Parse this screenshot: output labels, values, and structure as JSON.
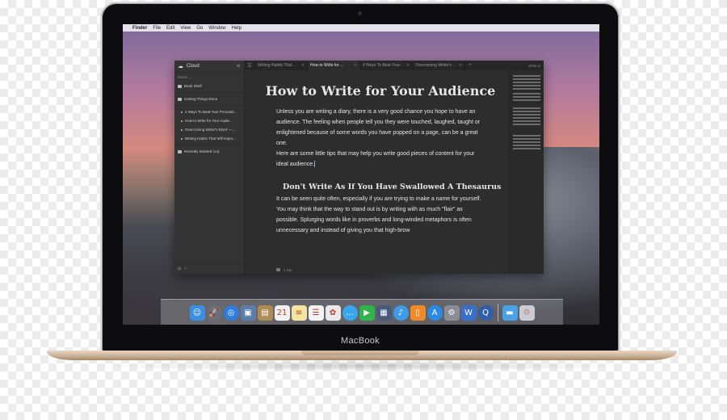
{
  "device": {
    "brand": "MacBook"
  },
  "menubar": {
    "items": [
      "Finder",
      "File",
      "Edit",
      "View",
      "Go",
      "Window",
      "Help"
    ]
  },
  "sidebar": {
    "header": "Cloud",
    "subheader": "Name",
    "items": [
      {
        "label": "Book Shelf",
        "type": "folder"
      },
      {
        "label": "Getting Things Done",
        "type": "folder"
      },
      {
        "label": "4 Ways To Beat Your Procrasti...",
        "type": "doc"
      },
      {
        "label": "How to Write for Your Audie...",
        "type": "doc"
      },
      {
        "label": "Overcoming Writer's Block —...",
        "type": "doc"
      },
      {
        "label": "Writing Habits That Will Impro...",
        "type": "doc"
      },
      {
        "label": "Recently Deleted (14)",
        "type": "trash"
      }
    ]
  },
  "tabs": [
    {
      "label": "Writing Habits That ...",
      "active": false
    },
    {
      "label": "How to Write for ...",
      "active": true
    },
    {
      "label": "4 Ways To Beat Your...",
      "active": false
    },
    {
      "label": "Overcoming Writer's ...",
      "active": false
    }
  ],
  "tabs_right": "Write &",
  "document": {
    "title": "How to Write for Your Audience",
    "paragraph1": "Unless you are writing a diary, there is a very good chance you hope to have an audience. The feeling when people tell you they were touched, laughed, taught or enlightened because of some words you have popped on a page, can be a great one.",
    "paragraph2": "Here are some little tips that may help you write good pieces of content for your ideal audience.",
    "heading2": "Don't Write As If You Have Swallowed A Thesaurus",
    "paragraph3": "It can be seen quite often, especially if you are trying to make a name for yourself. You may think that the way to stand out is by writing with as much \"flair\" as possible. Splurging words like in proverbs and long-winded metaphors is often unnecessary and instead of giving you that high-brow",
    "footer": "1 KB"
  },
  "dock": {
    "icons": [
      {
        "name": "finder",
        "glyph": "☺",
        "color": "#3b8ee0"
      },
      {
        "name": "launchpad",
        "glyph": "🚀",
        "color": "#6c6f78"
      },
      {
        "name": "safari",
        "glyph": "◎",
        "color": "#2f7de0"
      },
      {
        "name": "preview",
        "glyph": "▣",
        "color": "#5b7fa8"
      },
      {
        "name": "contacts",
        "glyph": "▤",
        "color": "#b08a55"
      },
      {
        "name": "calendar",
        "glyph": "21",
        "color": "#f2f2f2"
      },
      {
        "name": "notes",
        "glyph": "≡",
        "color": "#f4e3a1"
      },
      {
        "name": "reminders",
        "glyph": "☰",
        "color": "#f2f2f2"
      },
      {
        "name": "photos",
        "glyph": "✿",
        "color": "#e9e9e9"
      },
      {
        "name": "messages",
        "glyph": "…",
        "color": "#3aa6f0"
      },
      {
        "name": "facetime",
        "glyph": "▶",
        "color": "#2fb34a"
      },
      {
        "name": "photobooth",
        "glyph": "▦",
        "color": "#4a5a7a"
      },
      {
        "name": "itunes",
        "glyph": "♪",
        "color": "#3e9be8"
      },
      {
        "name": "ibooks",
        "glyph": "▯",
        "color": "#f08a26"
      },
      {
        "name": "appstore",
        "glyph": "A",
        "color": "#2b8ae6"
      },
      {
        "name": "system-preferences",
        "glyph": "⚙",
        "color": "#8a8d94"
      },
      {
        "name": "writer",
        "glyph": "W",
        "color": "#3a6fc9"
      },
      {
        "name": "quicktime",
        "glyph": "Q",
        "color": "#2f5fa8"
      }
    ],
    "right_icons": [
      {
        "name": "downloads-folder",
        "glyph": "▬",
        "color": "#4aa3e8"
      },
      {
        "name": "trash",
        "glyph": "♲",
        "color": "#c9ccd2"
      }
    ]
  }
}
